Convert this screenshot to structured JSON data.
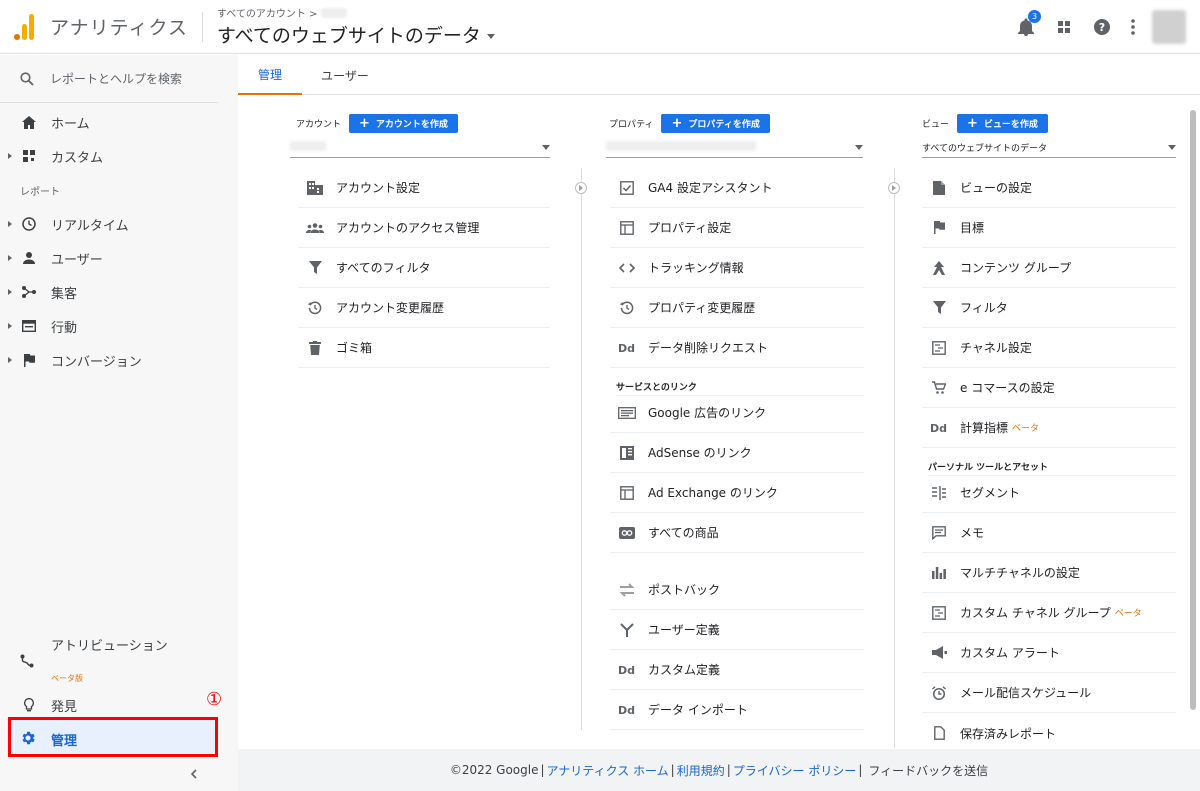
{
  "header": {
    "app_title": "アナリティクス",
    "crumb": "すべてのアカウント >",
    "view_name": "すべてのウェブサイトのデータ",
    "notifications_count": "3"
  },
  "sidebar": {
    "search_placeholder": "レポートとヘルプを検索",
    "home": "ホーム",
    "custom": "カスタム",
    "reports_label": "レポート",
    "realtime": "リアルタイム",
    "user": "ユーザー",
    "acquisition": "集客",
    "behavior": "行動",
    "conversion": "コンバージョン",
    "attribution": "アトリビューション",
    "attribution_beta": "ベータ版",
    "discover": "発見",
    "admin": "管理",
    "annotation": "①"
  },
  "tabs": {
    "admin": "管理",
    "user": "ユーザー"
  },
  "account": {
    "label": "アカウント",
    "create": "アカウントを作成",
    "items": [
      "アカウント設定",
      "アカウントのアクセス管理",
      "すべてのフィルタ",
      "アカウント変更履歴",
      "ゴミ箱"
    ]
  },
  "property": {
    "label": "プロパティ",
    "create": "プロパティを作成",
    "items": [
      "GA4 設定アシスタント",
      "プロパティ設定",
      "トラッキング情報",
      "プロパティ変更履歴",
      "データ削除リクエスト"
    ],
    "links_label": "サービスとのリンク",
    "links": [
      "Google 広告のリンク",
      "AdSense のリンク",
      "Ad Exchange のリンク",
      "すべての商品"
    ],
    "more": [
      "ポストバック",
      "ユーザー定義",
      "カスタム定義",
      "データ インポート"
    ]
  },
  "view": {
    "label": "ビュー",
    "create": "ビューを作成",
    "selected": "すべてのウェブサイトのデータ",
    "items": [
      "ビューの設定",
      "目標",
      "コンテンツ グループ",
      "フィルタ",
      "チャネル設定",
      "e コマースの設定",
      "計算指標"
    ],
    "beta": "ベータ",
    "personal_label": "パーソナル ツールとアセット",
    "personal": [
      "セグメント",
      "メモ",
      "マルチチャネルの設定",
      "カスタム チャネル グループ",
      "カスタム アラート",
      "メール配信スケジュール",
      "保存済みレポート"
    ]
  },
  "footer": {
    "copyright": "©2022 Google",
    "home": "アナリティクス ホーム",
    "terms": "利用規約",
    "privacy": "プライバシー ポリシー",
    "feedback": "フィードバックを送信"
  },
  "colors": {
    "accent": "#1a73e8",
    "highlight": "#ff0000",
    "beta": "#e8710a"
  }
}
